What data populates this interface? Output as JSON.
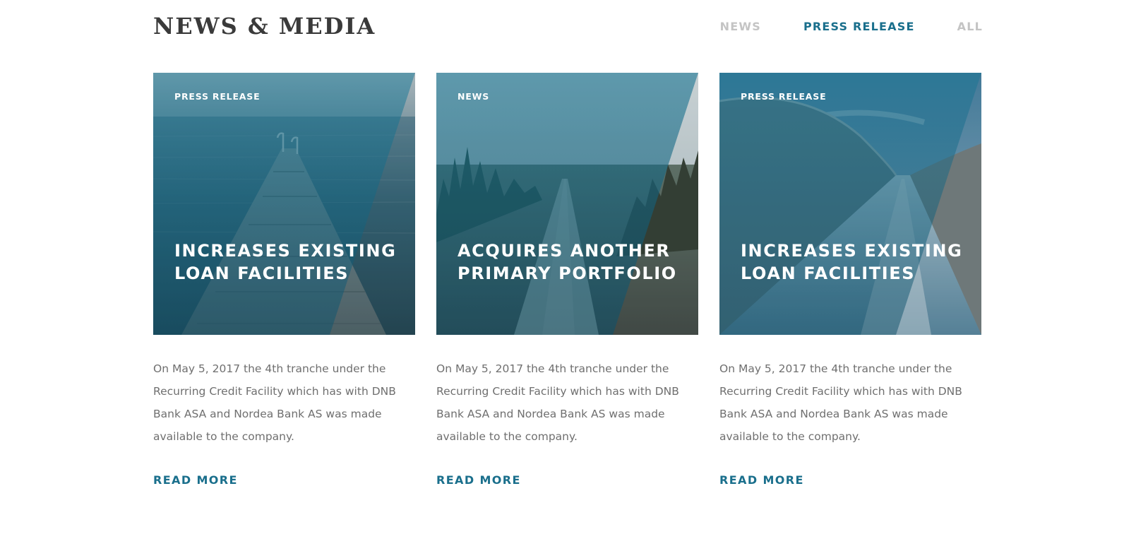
{
  "header": {
    "title": "NEWS & MEDIA",
    "filters": [
      {
        "label": "NEWS",
        "active": false
      },
      {
        "label": "PRESS RELEASE",
        "active": true
      },
      {
        "label": "ALL",
        "active": false
      }
    ]
  },
  "colors": {
    "accent": "#1a6f8c",
    "filter_inactive": "#c4c4c4",
    "body_text": "#6f6f6f",
    "title_text": "#3a3a3a"
  },
  "cards": [
    {
      "category": "PRESS RELEASE",
      "title": "INCREASES EXISTING LOAN FACILITIES",
      "excerpt": "On May 5, 2017 the 4th tranche under the Recurring Credit Facility which has with DNB Bank ASA and Nordea Bank AS was made available to the company.",
      "link_label": "READ MORE",
      "image": "pier-over-lake"
    },
    {
      "category": "NEWS",
      "title": "ACQUIRES ANOTHER PRIMARY PORTFOLIO",
      "excerpt": "On May 5, 2017 the 4th tranche under the Recurring Credit Facility which has with DNB Bank ASA and Nordea Bank AS was made available to the company.",
      "link_label": "READ MORE",
      "image": "dirt-road-through-forest"
    },
    {
      "category": "PRESS RELEASE",
      "title": "INCREASES EXISTING LOAN FACILITIES",
      "excerpt": "On May 5, 2017 the 4th tranche under the Recurring Credit Facility which has with DNB Bank ASA and Nordea Bank AS was made available to the company.",
      "link_label": "READ MORE",
      "image": "canal-between-hills"
    }
  ]
}
